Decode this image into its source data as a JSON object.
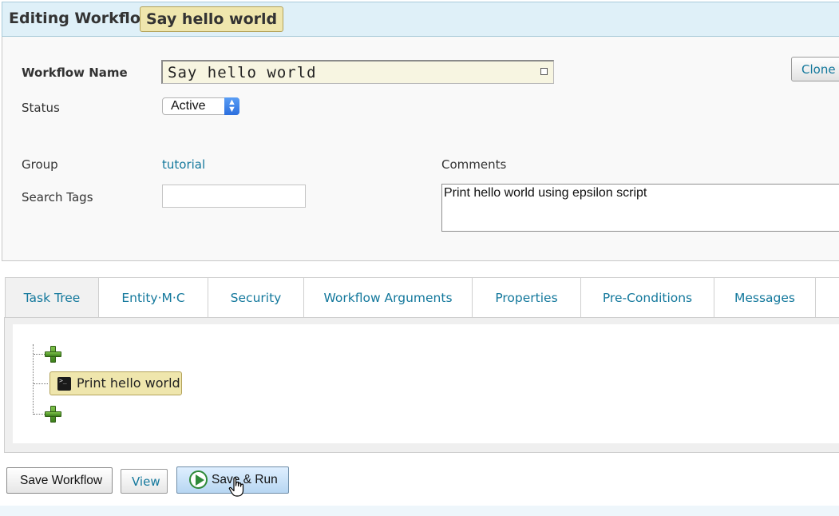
{
  "header": {
    "title": "Editing Workflow",
    "workflow_badge": "Say hello world"
  },
  "form": {
    "name_label": "Workflow Name",
    "name_value": "Say hello world",
    "status_label": "Status",
    "status_value": "Active",
    "group_label": "Group",
    "group_value": "tutorial",
    "tags_label": "Search Tags",
    "tags_value": "",
    "comments_label": "Comments",
    "comments_value": "Print hello world using epsilon script",
    "clone_label": "Clone"
  },
  "tabs": [
    {
      "label": "Task Tree",
      "active": true
    },
    {
      "label": "Entity·M·C",
      "active": false
    },
    {
      "label": "Security",
      "active": false
    },
    {
      "label": "Workflow Arguments",
      "active": false
    },
    {
      "label": "Properties",
      "active": false
    },
    {
      "label": "Pre-Conditions",
      "active": false
    },
    {
      "label": "Messages",
      "active": false
    }
  ],
  "task_tree": {
    "task_label": "Print hello world",
    "task_icon": "terminal-icon",
    "add_icon": "plus-icon"
  },
  "actions": {
    "save_label": "Save Workflow",
    "view_label": "View",
    "run_label": "Save & Run",
    "run_icon": "play-icon"
  },
  "colors": {
    "link": "#13789c",
    "badge": "#efe6ad",
    "header_bg": "#dff0f8"
  }
}
